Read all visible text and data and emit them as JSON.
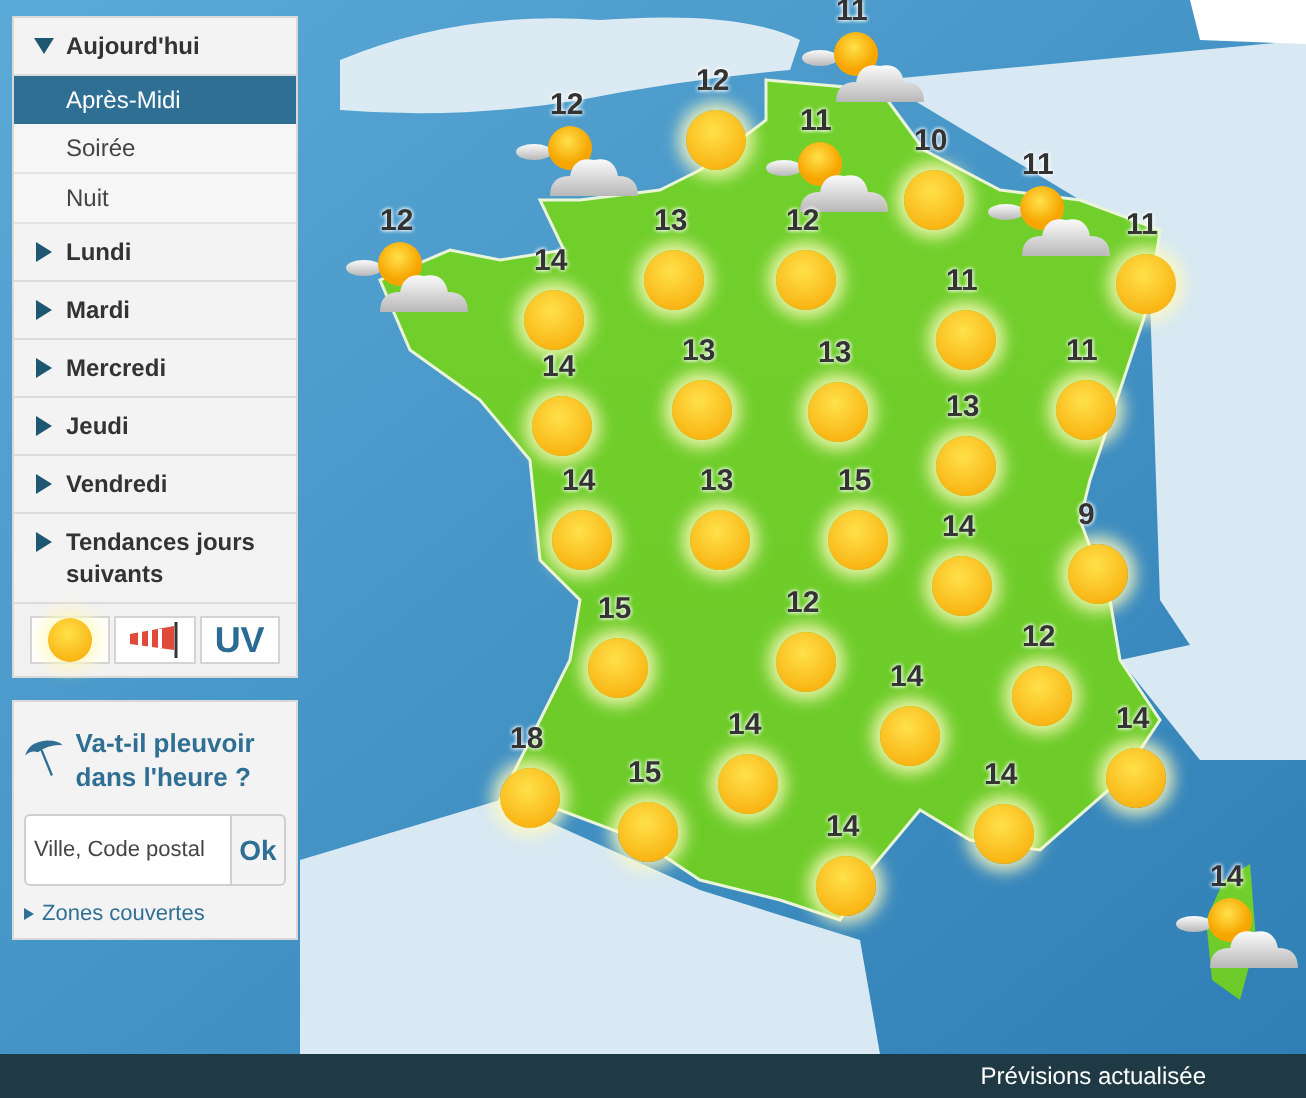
{
  "sidebar": {
    "days": [
      {
        "label": "Aujourd'hui",
        "expanded": true,
        "children": [
          {
            "label": "Après-Midi",
            "selected": true
          },
          {
            "label": "Soirée",
            "selected": false
          },
          {
            "label": "Nuit",
            "selected": false
          }
        ]
      },
      {
        "label": "Lundi",
        "expanded": false
      },
      {
        "label": "Mardi",
        "expanded": false
      },
      {
        "label": "Mercredi",
        "expanded": false
      },
      {
        "label": "Jeudi",
        "expanded": false
      },
      {
        "label": "Vendredi",
        "expanded": false
      },
      {
        "label": "Tendances jours suivants",
        "expanded": false
      }
    ],
    "view_buttons": [
      {
        "kind": "sun"
      },
      {
        "kind": "wind"
      },
      {
        "kind": "text",
        "label": "UV"
      }
    ]
  },
  "rain_box": {
    "title": "Va-t-il pleuvoir dans l'heure ?",
    "placeholder": "Ville, Code postal",
    "button": "Ok",
    "link": "Zones couvertes"
  },
  "map": {
    "markers": [
      {
        "temp": "11",
        "kind": "sun_cloud"
      },
      {
        "temp": "12",
        "kind": "sun"
      },
      {
        "temp": "12",
        "kind": "sun_cloud"
      },
      {
        "temp": "11",
        "kind": "sun_cloud"
      },
      {
        "temp": "10",
        "kind": "sun"
      },
      {
        "temp": "11",
        "kind": "sun_cloud"
      },
      {
        "temp": "12",
        "kind": "sun_cloud"
      },
      {
        "temp": "13",
        "kind": "sun"
      },
      {
        "temp": "12",
        "kind": "sun"
      },
      {
        "temp": "11",
        "kind": "sun"
      },
      {
        "temp": "14",
        "kind": "sun"
      },
      {
        "temp": "11",
        "kind": "sun"
      },
      {
        "temp": "14",
        "kind": "sun"
      },
      {
        "temp": "13",
        "kind": "sun"
      },
      {
        "temp": "13",
        "kind": "sun"
      },
      {
        "temp": "11",
        "kind": "sun"
      },
      {
        "temp": "13",
        "kind": "sun"
      },
      {
        "temp": "14",
        "kind": "sun"
      },
      {
        "temp": "13",
        "kind": "sun"
      },
      {
        "temp": "15",
        "kind": "sun"
      },
      {
        "temp": "14",
        "kind": "sun"
      },
      {
        "temp": "9",
        "kind": "sun"
      },
      {
        "temp": "15",
        "kind": "sun"
      },
      {
        "temp": "12",
        "kind": "sun"
      },
      {
        "temp": "12",
        "kind": "sun"
      },
      {
        "temp": "14",
        "kind": "sun"
      },
      {
        "temp": "18",
        "kind": "sun"
      },
      {
        "temp": "14",
        "kind": "sun"
      },
      {
        "temp": "14",
        "kind": "sun"
      },
      {
        "temp": "15",
        "kind": "sun"
      },
      {
        "temp": "14",
        "kind": "sun"
      },
      {
        "temp": "14",
        "kind": "sun"
      },
      {
        "temp": "14",
        "kind": "sun_cloud"
      }
    ]
  },
  "status_bar": {
    "text": "Prévisions actualisée"
  }
}
